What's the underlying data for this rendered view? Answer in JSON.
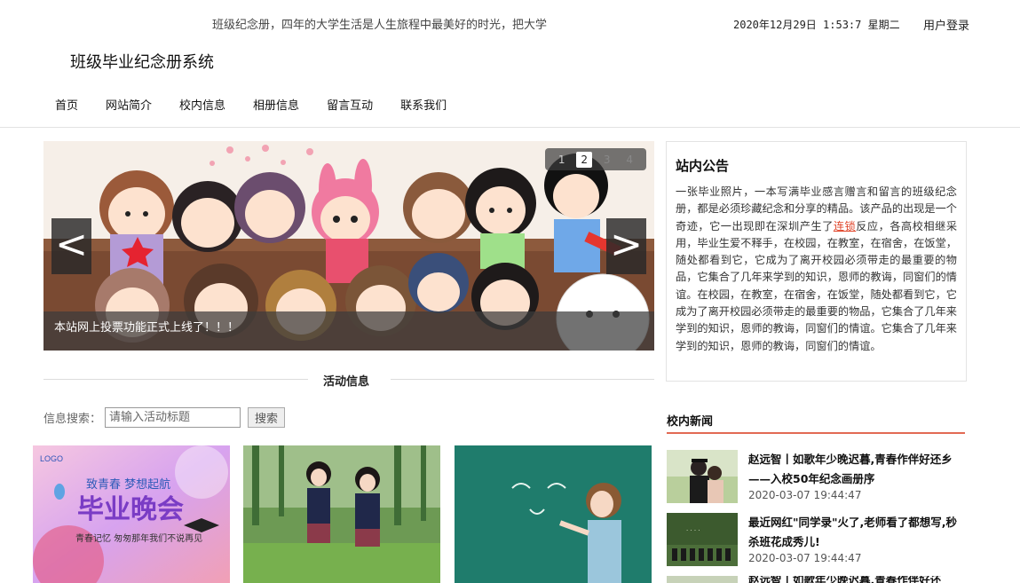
{
  "header": {
    "marquee": "班级纪念册，四年的大学生活是人生旅程中最美好的时光，把大学",
    "datetime": "2020年12月29日 1:53:7 星期二",
    "login": "用户登录",
    "site_title": "班级毕业纪念册系统"
  },
  "nav": {
    "items": [
      "首页",
      "网站简介",
      "校内信息",
      "相册信息",
      "留言互动",
      "联系我们"
    ]
  },
  "carousel": {
    "prev_glyph": "<",
    "next_glyph": ">",
    "dots": [
      "1",
      "2",
      "3",
      "4"
    ],
    "active_index": 2,
    "caption": "本站网上投票功能正式上线了！！！"
  },
  "activity": {
    "title": "活动信息",
    "search_label": "信息搜索：",
    "search_placeholder": "请输入活动标题",
    "search_button": "搜索",
    "poster_text": {
      "logo": "LOGO",
      "slogan": "致青春 梦想起航",
      "main": "毕业晚会",
      "sub": "青春记忆 匆匆那年我们不说再见"
    }
  },
  "notice": {
    "title": "站内公告",
    "text_before": "一张毕业照片，一本写满毕业感言赠言和留言的班级纪念册，都是必须珍藏纪念和分享的精品。该产品的出现是一个奇迹，它一出现即在深圳产生了",
    "highlight": "连锁",
    "text_after": "反应，各高校相继采用，毕业生爱不释手，在校园，在教室，在宿舍，在饭堂，随处都看到它，它成为了离开校园必须带走的最重要的物品，它集合了几年来学到的知识，恩师的教诲，同窗们的情谊。在校园，在教室，在宿舍，在饭堂，随处都看到它，它成为了离开校园必须带走的最重要的物品，它集合了几年来学到的知识，恩师的教诲，同窗们的情谊。它集合了几年来学到的知识，恩师的教诲，同窗们的情谊。"
  },
  "news": {
    "title": "校内新闻",
    "items": [
      {
        "title": "赵远智丨如歌年少晚迟暮,青春作伴好还乡——入校50年纪念画册序",
        "date": "2020-03-07 19:44:47"
      },
      {
        "title": "最近网红\"同学录\"火了,老师看了都想写,秒杀班花成秀儿!",
        "date": "2020-03-07 19:44:47"
      },
      {
        "title": "赵远智丨如歌年少晚迟暮,青春作伴好还",
        "date": ""
      }
    ]
  },
  "colors": {
    "accent": "#e26a54",
    "highlight": "#e0452a"
  }
}
